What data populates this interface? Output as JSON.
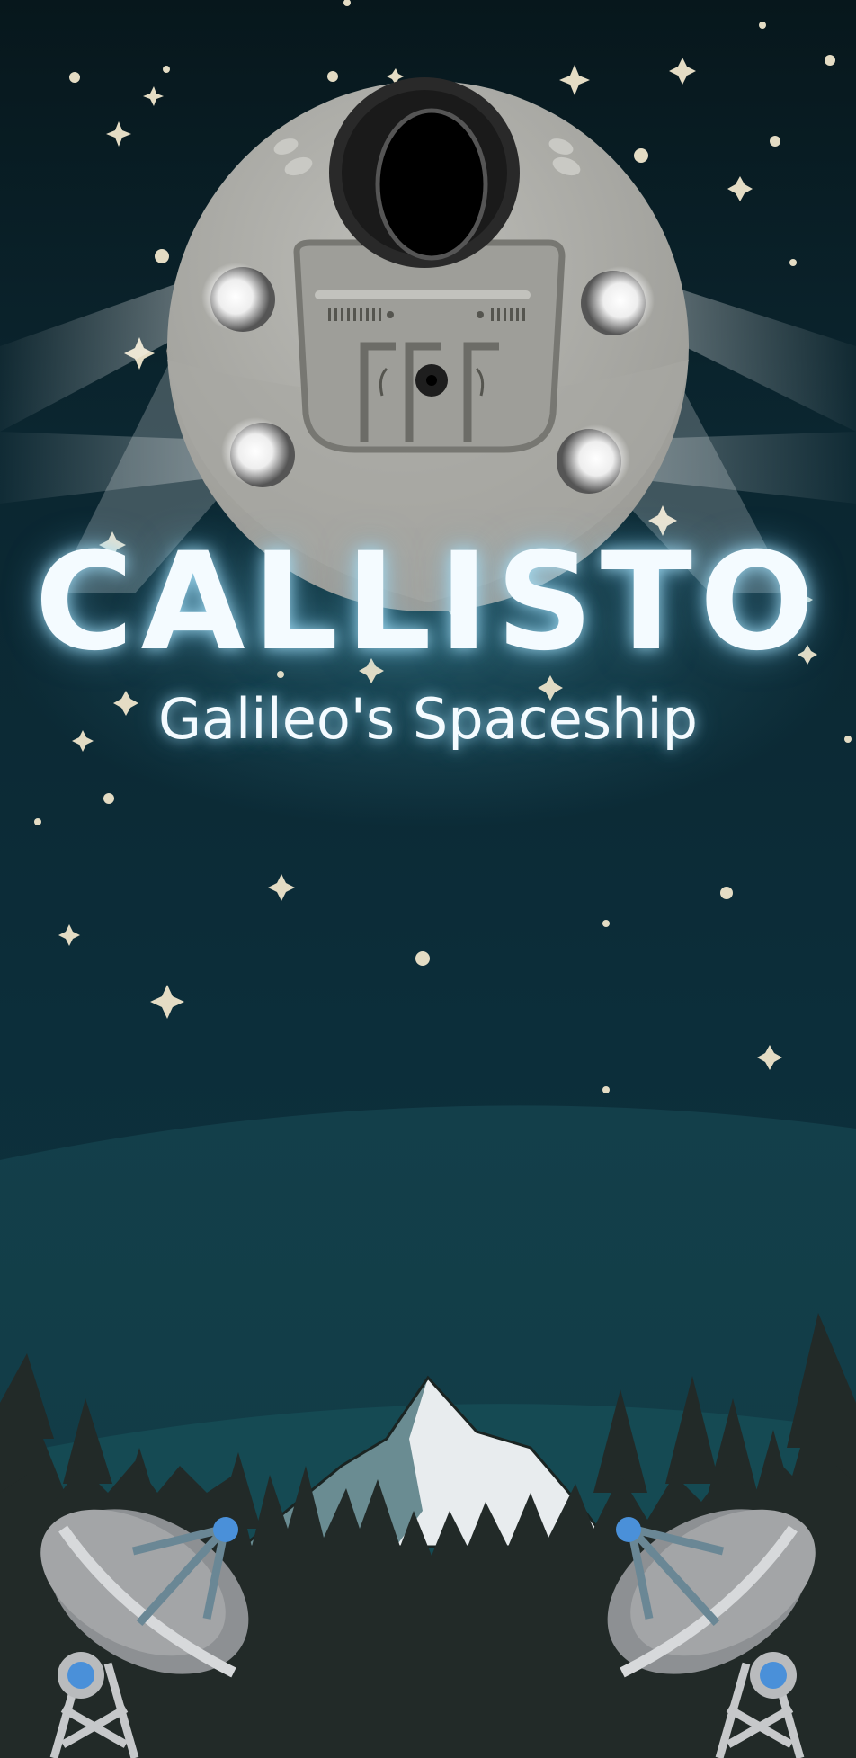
{
  "title": "CALLISTO",
  "subtitle": "Galileo's Spaceship",
  "colors": {
    "sky_top": "#08181d",
    "sky_mid": "#0c2c38",
    "horizon": "#123f4a",
    "forest": "#212a28",
    "ship_hull": "#a9a9a4",
    "ship_dark": "#7a7a75",
    "star": "#e4dcc4",
    "dish": "#a3a5a7",
    "dish_accent": "#4a90d9",
    "snow": "#e8ecee",
    "mountain_shadow": "#6a8c92"
  },
  "icons": [
    "spaceship-icon",
    "satellite-dish-icon",
    "mountain-icon",
    "pine-tree-icon",
    "star-icon"
  ]
}
